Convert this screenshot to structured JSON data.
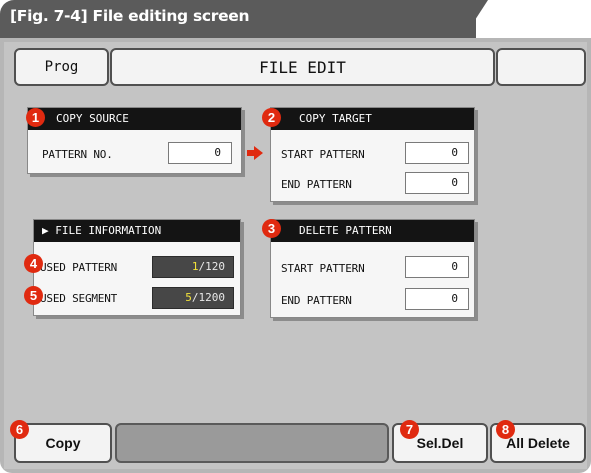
{
  "caption": "[Fig. 7-4] File editing screen",
  "header": {
    "prog_label": "Prog",
    "title": "FILE EDIT",
    "right_label": ""
  },
  "copy_source": {
    "badge": "1",
    "title": "COPY SOURCE",
    "pattern_label": "PATTERN NO.",
    "pattern_value": "0"
  },
  "copy_target": {
    "badge": "2",
    "title": "COPY TARGET",
    "start_label": "START PATTERN",
    "start_value": "0",
    "end_label": "END PATTERN",
    "end_value": "0"
  },
  "file_information": {
    "title": "▶ FILE INFORMATION",
    "used_pattern_badge": "4",
    "used_pattern_label": "USED PATTERN",
    "used_pattern_used": "1",
    "used_pattern_total": "/120",
    "used_segment_badge": "5",
    "used_segment_label": "USED SEGMENT",
    "used_segment_used": "5",
    "used_segment_total": "/1200"
  },
  "delete_pattern": {
    "badge": "3",
    "title": "DELETE PATTERN",
    "start_label": "START PATTERN",
    "start_value": "0",
    "end_label": "END PATTERN",
    "end_value": "0"
  },
  "footer": {
    "copy_badge": "6",
    "copy_label": "Copy",
    "status_text": "",
    "seldel_badge": "7",
    "seldel_label": "Sel.Del",
    "alldelete_badge": "8",
    "alldelete_label": "All Delete"
  },
  "colors": {
    "badge": "#e02a10",
    "arrow": "#e02a10",
    "panel_title_bg": "#141414",
    "highlight_value": "#f2e23a",
    "screen_bg": "#c4c4c4"
  }
}
